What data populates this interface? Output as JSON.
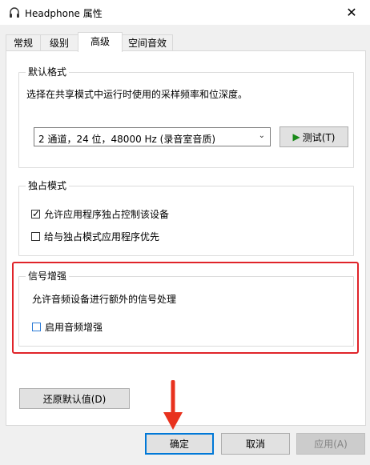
{
  "window": {
    "title": "Headphone 属性",
    "close_glyph": "✕",
    "icon": "headphone-icon"
  },
  "tabs": [
    {
      "label": "常规"
    },
    {
      "label": "级别"
    },
    {
      "label": "高级"
    },
    {
      "label": "空间音效"
    }
  ],
  "default_format": {
    "title": "默认格式",
    "description": "选择在共享模式中运行时使用的采样频率和位深度。",
    "selected": "2 通道，24 位，48000 Hz (录音室音质)",
    "test_button": "测试(T)"
  },
  "exclusive_mode": {
    "title": "独占模式",
    "allow_exclusive": {
      "label": "允许应用程序独占控制该设备",
      "checked": true
    },
    "give_priority": {
      "label": "给与独占模式应用程序优先",
      "checked": false
    }
  },
  "signal_enhance": {
    "title": "信号增强",
    "description": "允许音频设备进行额外的信号处理",
    "enable_audio_enhance": {
      "label": "启用音频增强",
      "checked": false
    }
  },
  "restore_defaults_button": "还原默认值(D)",
  "footer": {
    "ok": "确定",
    "cancel": "取消",
    "apply": "应用(A)"
  },
  "colors": {
    "highlight_box": "#e0242a",
    "annotation_arrow": "#e8321e",
    "default_button_border": "#0078d7"
  }
}
